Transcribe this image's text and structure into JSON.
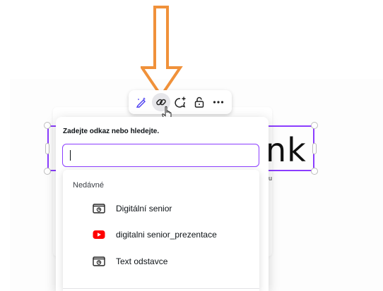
{
  "toolbar": {
    "buttons": [
      {
        "name": "magic-edit",
        "icon": "magic-pencil-icon"
      },
      {
        "name": "link",
        "icon": "link-icon",
        "active": true
      },
      {
        "name": "comment",
        "icon": "comment-plus-icon"
      },
      {
        "name": "lock",
        "icon": "lock-icon"
      },
      {
        "name": "more",
        "icon": "more-icon"
      }
    ]
  },
  "canvas": {
    "visible_text": "nk",
    "tiny_mark": "u"
  },
  "link_popover": {
    "label": "Zadejte odkaz nebo hledejte.",
    "input_value": "",
    "recent": {
      "heading": "Nedávné",
      "items": [
        {
          "label": "Digitální senior",
          "icon": "presentation-icon"
        },
        {
          "label": "digitalni senior_prezentace",
          "icon": "youtube-icon"
        },
        {
          "label": "Text odstavce",
          "icon": "presentation-icon"
        }
      ]
    }
  },
  "colors": {
    "accent": "#8b3dff",
    "arrow": "#f0913a",
    "youtube": "#ff0000"
  }
}
